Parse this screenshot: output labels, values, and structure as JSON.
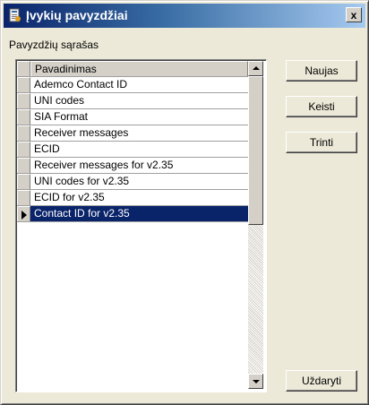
{
  "window": {
    "title": "Įvykių pavyzdžiai",
    "close_label": "x"
  },
  "list": {
    "label": "Pavyzdžių sąrašas",
    "column_header": "Pavadinimas",
    "items": [
      "Ademco Contact ID",
      "UNI codes",
      "SIA Format",
      "Receiver messages",
      "ECID",
      "Receiver messages for v2.35",
      "UNI codes for v2.35",
      "ECID for v2.35",
      "Contact ID for v2.35"
    ],
    "selected_index": 8
  },
  "buttons": {
    "new": "Naujas",
    "edit": "Keisti",
    "delete": "Trinti",
    "close": "Uždaryti"
  },
  "colors": {
    "title_start": "#0a246a",
    "title_end": "#a6caf0",
    "selection": "#0a246a",
    "face": "#ece9d8"
  }
}
